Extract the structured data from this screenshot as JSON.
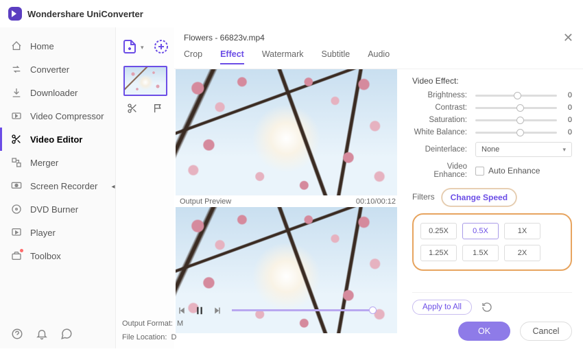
{
  "titlebar": {
    "app_name": "Wondershare UniConverter"
  },
  "sidebar": {
    "items": [
      {
        "label": "Home"
      },
      {
        "label": "Converter"
      },
      {
        "label": "Downloader"
      },
      {
        "label": "Video Compressor"
      },
      {
        "label": "Video Editor"
      },
      {
        "label": "Merger"
      },
      {
        "label": "Screen Recorder"
      },
      {
        "label": "DVD Burner"
      },
      {
        "label": "Player"
      },
      {
        "label": "Toolbox"
      }
    ]
  },
  "editor": {
    "filename": "Flowers - 66823v.mp4",
    "tabs": [
      "Crop",
      "Effect",
      "Watermark",
      "Subtitle",
      "Audio"
    ],
    "active_tab": "Effect",
    "output_preview_label": "Output Preview",
    "time_display": "00:10/00:12",
    "video_effect": {
      "title": "Video Effect:",
      "sliders": [
        {
          "label": "Brightness:",
          "value": "0",
          "pos": 47
        },
        {
          "label": "Contrast:",
          "value": "0",
          "pos": 50
        },
        {
          "label": "Saturation:",
          "value": "0",
          "pos": 50
        },
        {
          "label": "White Balance:",
          "value": "0",
          "pos": 50
        }
      ],
      "deinterlace_label": "Deinterlace:",
      "deinterlace_value": "None",
      "enhance_label": "Video Enhance:",
      "auto_enhance_label": "Auto Enhance"
    },
    "subtabs": {
      "filters": "Filters",
      "speed": "Change Speed"
    },
    "speed_options": [
      "0.25X",
      "0.5X",
      "1X",
      "1.25X",
      "1.5X",
      "2X"
    ],
    "selected_speed": "0.5X",
    "apply_all": "Apply to All",
    "ok": "OK",
    "cancel": "Cancel",
    "output_format_label": "Output Format:",
    "output_format_value": "M",
    "file_location_label": "File Location:",
    "file_location_value": "D"
  }
}
